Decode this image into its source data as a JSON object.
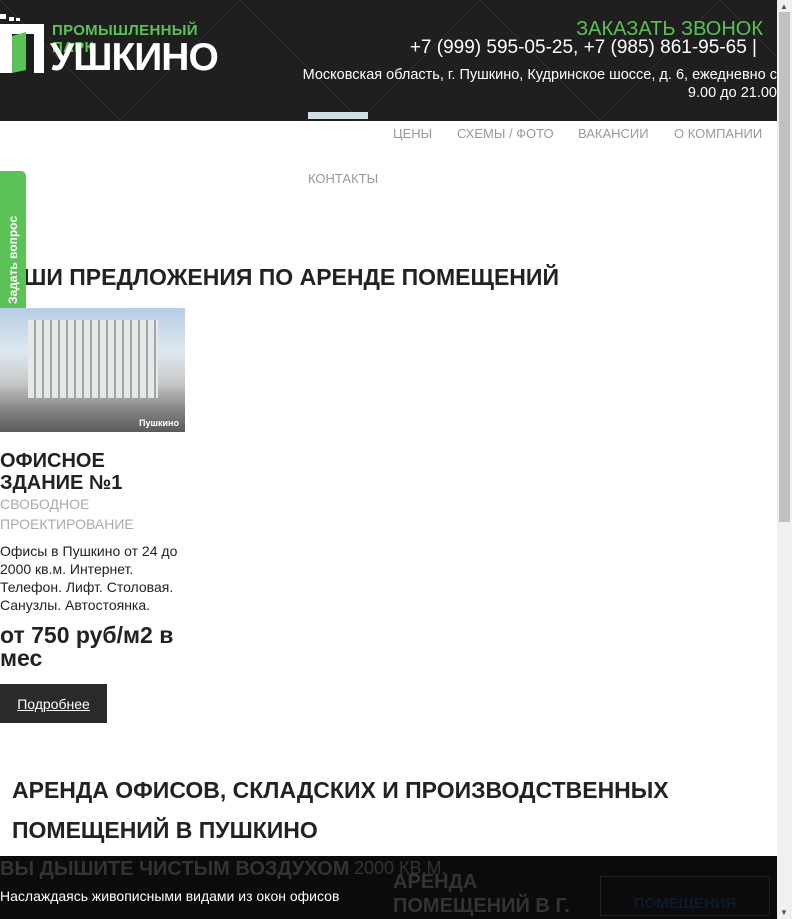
{
  "header": {
    "logo_sub": "ПРОМЫШЛЕННЫЙ ПАРК",
    "logo_name": "УШКИНО",
    "callback": "ЗАКАЗАТЬ ЗВОНОК",
    "phones": "+7 (999) 595-05-25, +7 (985) 861-95-65 |",
    "address": "Московская область, г. Пушкино, Кудринское шоссе, д. 6, ежедневно с 9.00 до 21.00"
  },
  "nav": [
    "ЦЕНЫ",
    "СХЕМЫ / ФОТО",
    "ВАКАНСИИ",
    "О КОМПАНИИ",
    "КОНТАКТЫ"
  ],
  "side_tab": "Задать вопрос",
  "offers": {
    "heading": "НАШИ ПРЕДЛОЖЕНИЯ ПО АРЕНДЕ ПОМЕЩЕНИЙ",
    "card": {
      "watermark": "Пушкино",
      "title": "ОФИСНОЕ ЗДАНИЕ №1",
      "subtitle": "СВОБОДНОЕ ПРОЕКТИРОВАНИЕ",
      "description": "Офисы в Пушкино от 24 до 2000 кв.м. Интернет. Телефон. Лифт. Столовая. Санузлы. Автостоянка.",
      "price": "от 750 руб/м2 в мес",
      "button": "Подробнее"
    }
  },
  "main_heading": "АРЕНДА ОФИСОВ, СКЛАДСКИХ И ПРОИЗВОДСТВЕННЫХ ПОМЕЩЕНИЙ В ПУШКИНО",
  "slider": {
    "title": "ВЫ ДЫШИТЕ ЧИСТЫМ ВОЗДУХОМ",
    "title_extra": "2000 КВ.М.",
    "caption": "Наслаждаясь живописными видами из окон офисов",
    "side_title": "АРЕНДА ПОМЕЩЕНИЙ В Г.",
    "badge": "ПОМЕЩЕНИЯ"
  }
}
